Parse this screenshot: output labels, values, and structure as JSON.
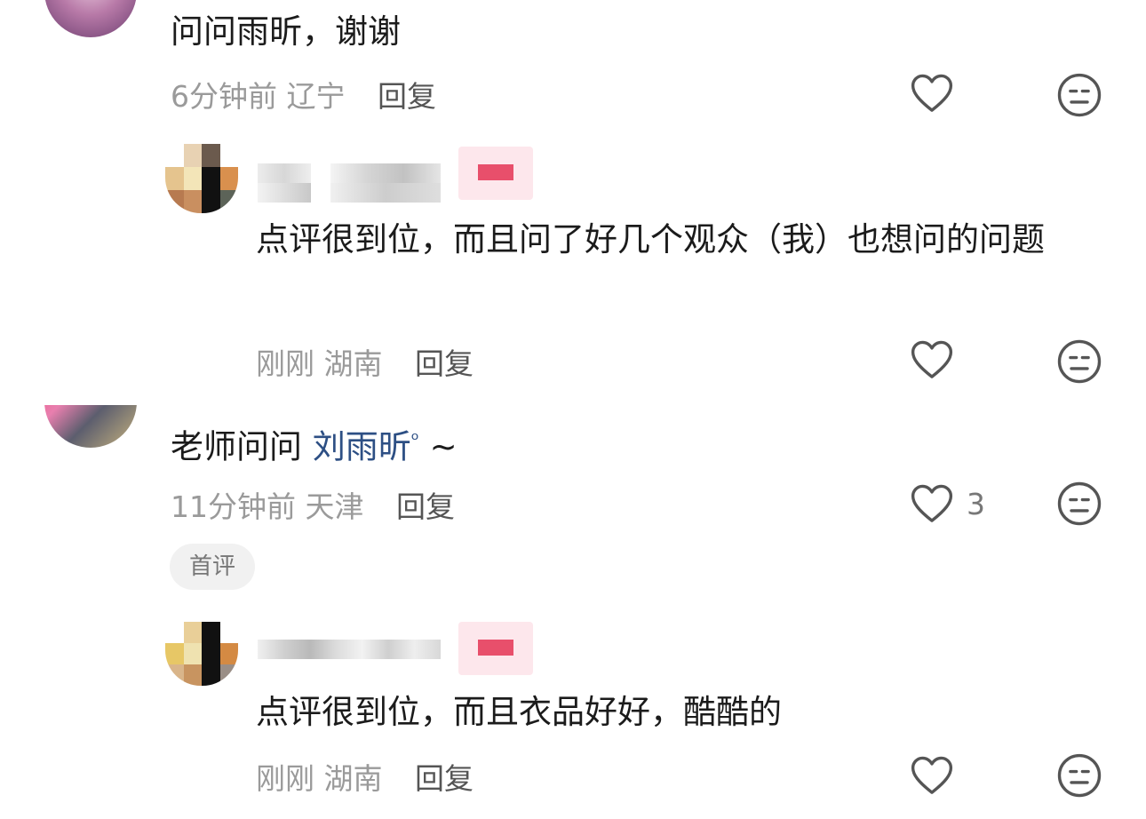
{
  "comments": [
    {
      "text": "问问雨昕，谢谢",
      "time": "6分钟前",
      "location": "辽宁",
      "reply_label": "回复",
      "replies": [
        {
          "text": "点评很到位，而且问了好几个观众（我）也想问的问题",
          "time": "刚刚",
          "location": "湖南",
          "reply_label": "回复"
        }
      ]
    },
    {
      "text_prefix": "老师问问 ",
      "mention": "刘雨昕",
      "text_suffix": " ~",
      "time": "11分钟前",
      "location": "天津",
      "reply_label": "回复",
      "like_count": "3",
      "badge": "首评",
      "replies": [
        {
          "text": "点评很到位，而且衣品好好，酷酷的",
          "time": "刚刚",
          "location": "湖南",
          "reply_label": "回复"
        }
      ]
    }
  ],
  "icons": {
    "like": "heart-outline-icon",
    "dislike": "meh-face-icon",
    "mention_search": "search-icon"
  }
}
